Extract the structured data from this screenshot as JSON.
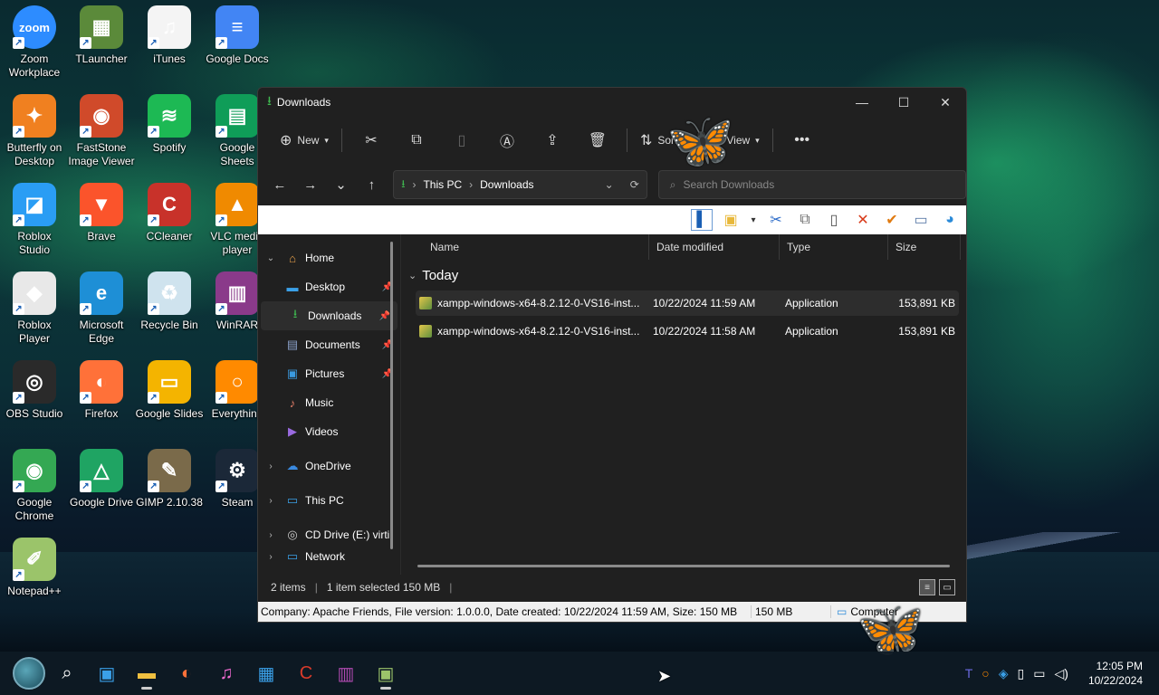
{
  "desktop": {
    "icons": [
      {
        "label": "Zoom\nWorkplace",
        "icon": "zoom-icon",
        "color": "#2d8cff",
        "glyph": "zoom"
      },
      {
        "label": "TLauncher",
        "icon": "tlauncher-icon",
        "color": "#5b8a3a",
        "glyph": "▦"
      },
      {
        "label": "iTunes",
        "icon": "itunes-icon",
        "color": "#f4f4f4",
        "glyph": "♫"
      },
      {
        "label": "Google Docs",
        "icon": "google-docs-icon",
        "color": "#4285f4",
        "glyph": "≡"
      },
      {
        "label": "Butterfly on\nDesktop",
        "icon": "butterfly-icon",
        "color": "#f08020",
        "glyph": "✦"
      },
      {
        "label": "FastStone\nImage Viewer",
        "icon": "faststone-icon",
        "color": "#d04a2a",
        "glyph": "◉"
      },
      {
        "label": "Spotify",
        "icon": "spotify-icon",
        "color": "#1db954",
        "glyph": "≋"
      },
      {
        "label": "Google\nSheets",
        "icon": "google-sheets-icon",
        "color": "#0f9d58",
        "glyph": "▤"
      },
      {
        "label": "Roblox\nStudio",
        "icon": "roblox-studio-icon",
        "color": "#2a9df4",
        "glyph": "◪"
      },
      {
        "label": "Brave",
        "icon": "brave-icon",
        "color": "#fb542b",
        "glyph": "▼"
      },
      {
        "label": "CCleaner",
        "icon": "ccleaner-icon",
        "color": "#c8322a",
        "glyph": "C"
      },
      {
        "label": "VLC media\nplayer",
        "icon": "vlc-icon",
        "color": "#f08a00",
        "glyph": "▲"
      },
      {
        "label": "Roblox\nPlayer",
        "icon": "roblox-player-icon",
        "color": "#e8e8e8",
        "glyph": "◆"
      },
      {
        "label": "Microsoft\nEdge",
        "icon": "edge-icon",
        "color": "#1e8fd6",
        "glyph": "e"
      },
      {
        "label": "Recycle Bin",
        "icon": "recycle-bin-icon",
        "color": "#cfe3ee",
        "glyph": "♻"
      },
      {
        "label": "WinRAR",
        "icon": "winrar-icon",
        "color": "#8a3a8a",
        "glyph": "▥"
      },
      {
        "label": "OBS Studio",
        "icon": "obs-icon",
        "color": "#2a2a2a",
        "glyph": "◎"
      },
      {
        "label": "Firefox",
        "icon": "firefox-icon",
        "color": "#ff7139",
        "glyph": "◐"
      },
      {
        "label": "Google Slides",
        "icon": "google-slides-icon",
        "color": "#f4b400",
        "glyph": "▭"
      },
      {
        "label": "Everything",
        "icon": "everything-icon",
        "color": "#ff8a00",
        "glyph": "○"
      },
      {
        "label": "Google\nChrome",
        "icon": "chrome-icon",
        "color": "#34a853",
        "glyph": "◉"
      },
      {
        "label": "Google Drive",
        "icon": "google-drive-icon",
        "color": "#1fa463",
        "glyph": "△"
      },
      {
        "label": "GIMP 2.10.38",
        "icon": "gimp-icon",
        "color": "#7a6a4a",
        "glyph": "✎"
      },
      {
        "label": "Steam",
        "icon": "steam-icon",
        "color": "#1b2838",
        "glyph": "⚙"
      },
      {
        "label": "Notepad++",
        "icon": "notepadpp-icon",
        "color": "#9bc46a",
        "glyph": "✐"
      }
    ]
  },
  "window": {
    "title": "Downloads",
    "controls": {
      "minimize": "—",
      "maximize": "☐",
      "close": "✕"
    },
    "toolbar": {
      "new_label": "New",
      "sort_label": "Sort",
      "view_label": "View",
      "more_label": "•••"
    },
    "address": {
      "crumbs": [
        "This PC",
        "Downloads"
      ],
      "search_placeholder": "Search Downloads"
    },
    "nav": {
      "home": "Home",
      "quick": [
        {
          "label": "Desktop",
          "icon": "desktop-folder-icon",
          "glyph": "▬",
          "color": "#3aa0e8",
          "pinned": true
        },
        {
          "label": "Downloads",
          "icon": "downloads-folder-icon",
          "glyph": "⭳",
          "color": "#3fb950",
          "pinned": true
        },
        {
          "label": "Documents",
          "icon": "documents-folder-icon",
          "glyph": "▤",
          "color": "#8aa0c8",
          "pinned": true
        },
        {
          "label": "Pictures",
          "icon": "pictures-folder-icon",
          "glyph": "▣",
          "color": "#3a9ae0",
          "pinned": true
        },
        {
          "label": "Music",
          "icon": "music-folder-icon",
          "glyph": "♪",
          "color": "#e8806a",
          "pinned": false
        },
        {
          "label": "Videos",
          "icon": "videos-folder-icon",
          "glyph": "▶",
          "color": "#9a6ae0",
          "pinned": false
        }
      ],
      "onedrive": "OneDrive",
      "thispc": "This PC",
      "cddrive": "CD Drive (E:) virti",
      "network": "Network"
    },
    "columns": {
      "name": "Name",
      "date": "Date modified",
      "type": "Type",
      "size": "Size"
    },
    "group": "Today",
    "files": [
      {
        "name": "xampp-windows-x64-8.2.12-0-VS16-inst...",
        "date": "10/22/2024 11:59 AM",
        "type": "Application",
        "size": "153,891 KB",
        "selected": true
      },
      {
        "name": "xampp-windows-x64-8.2.12-0-VS16-inst...",
        "date": "10/22/2024 11:58 AM",
        "type": "Application",
        "size": "153,891 KB",
        "selected": false
      }
    ],
    "status": {
      "items": "2 items",
      "selected": "1 item selected  150 MB"
    },
    "infobar": {
      "details": "Company: Apache Friends, File version: 1.0.0.0, Date created: 10/22/2024 11:59 AM, Size: 150 MB",
      "size": "150 MB",
      "location": "Computer"
    }
  },
  "taskbar": {
    "clock_time": "12:05 PM",
    "clock_date": "10/22/2024"
  }
}
